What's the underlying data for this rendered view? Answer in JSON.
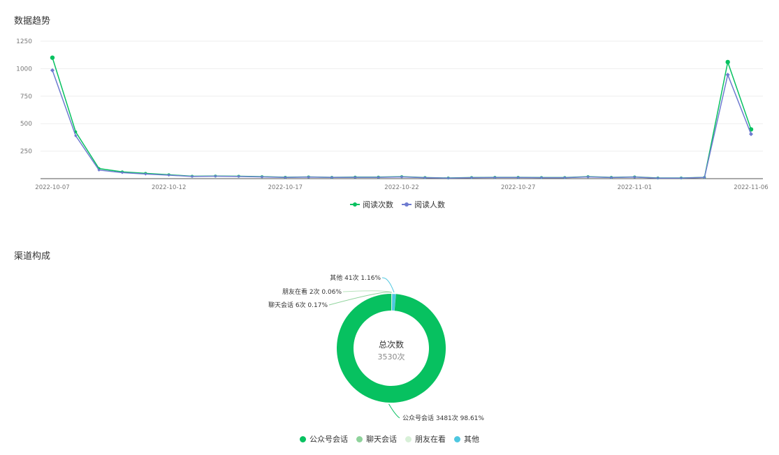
{
  "trend_section": {
    "title": "数据趋势"
  },
  "channel_section": {
    "title": "渠道构成"
  },
  "colors": {
    "green": "#07c160",
    "purple": "#6e7bd0",
    "light_green": "#8ed39b",
    "pale_green": "#d8f0d8",
    "cyan": "#4ec7e0",
    "grid": "#eeeeee",
    "axis_text": "#777777"
  },
  "chart_data": [
    {
      "type": "line",
      "title": "数据趋势",
      "x": [
        "2022-10-07",
        "2022-10-08",
        "2022-10-09",
        "2022-10-10",
        "2022-10-11",
        "2022-10-12",
        "2022-10-13",
        "2022-10-14",
        "2022-10-15",
        "2022-10-16",
        "2022-10-17",
        "2022-10-18",
        "2022-10-19",
        "2022-10-20",
        "2022-10-21",
        "2022-10-22",
        "2022-10-23",
        "2022-10-24",
        "2022-10-25",
        "2022-10-26",
        "2022-10-27",
        "2022-10-28",
        "2022-10-29",
        "2022-10-30",
        "2022-10-31",
        "2022-11-01",
        "2022-11-02",
        "2022-11-03",
        "2022-11-04",
        "2022-11-05",
        "2022-11-06"
      ],
      "x_tick_labels": [
        "2022-10-07",
        "2022-10-12",
        "2022-10-17",
        "2022-10-22",
        "2022-10-27",
        "2022-11-01",
        "2022-11-06"
      ],
      "y_ticks": [
        "250",
        "500",
        "750",
        "1000",
        "1250"
      ],
      "ylim": [
        0,
        1250
      ],
      "grid": true,
      "legend_position": "bottom-center",
      "series": [
        {
          "name": "阅读次数",
          "color": "#07c160",
          "marker": "circle",
          "values": [
            1100,
            425,
            92,
            62,
            48,
            36,
            22,
            24,
            22,
            18,
            13,
            16,
            12,
            14,
            14,
            18,
            10,
            6,
            10,
            12,
            12,
            10,
            10,
            18,
            12,
            16,
            6,
            6,
            12,
            1060,
            448
          ]
        },
        {
          "name": "阅读人数",
          "color": "#6e7bd0",
          "marker": "diamond",
          "values": [
            985,
            390,
            78,
            55,
            42,
            32,
            20,
            22,
            20,
            16,
            11,
            14,
            11,
            12,
            12,
            16,
            9,
            5,
            9,
            10,
            10,
            9,
            9,
            16,
            10,
            14,
            5,
            5,
            11,
            945,
            405
          ]
        }
      ]
    },
    {
      "type": "pie",
      "title": "渠道构成",
      "center_title": "总次数",
      "center_value": "3530次",
      "categories": [
        "公众号会话",
        "聊天会话",
        "朋友在看",
        "其他"
      ],
      "values": [
        3481,
        6,
        2,
        41
      ],
      "percent_labels": [
        "98.61%",
        "0.17%",
        "0.06%",
        "1.16%"
      ],
      "slice_labels": [
        "公众号会话 3481次 98.61%",
        "聊天会话 6次 0.17%",
        "朋友在看 2次 0.06%",
        "其他 41次 1.16%"
      ],
      "colors": [
        "#07c160",
        "#8ed39b",
        "#d8f0d8",
        "#4ec7e0"
      ],
      "legend_position": "bottom-center"
    }
  ]
}
